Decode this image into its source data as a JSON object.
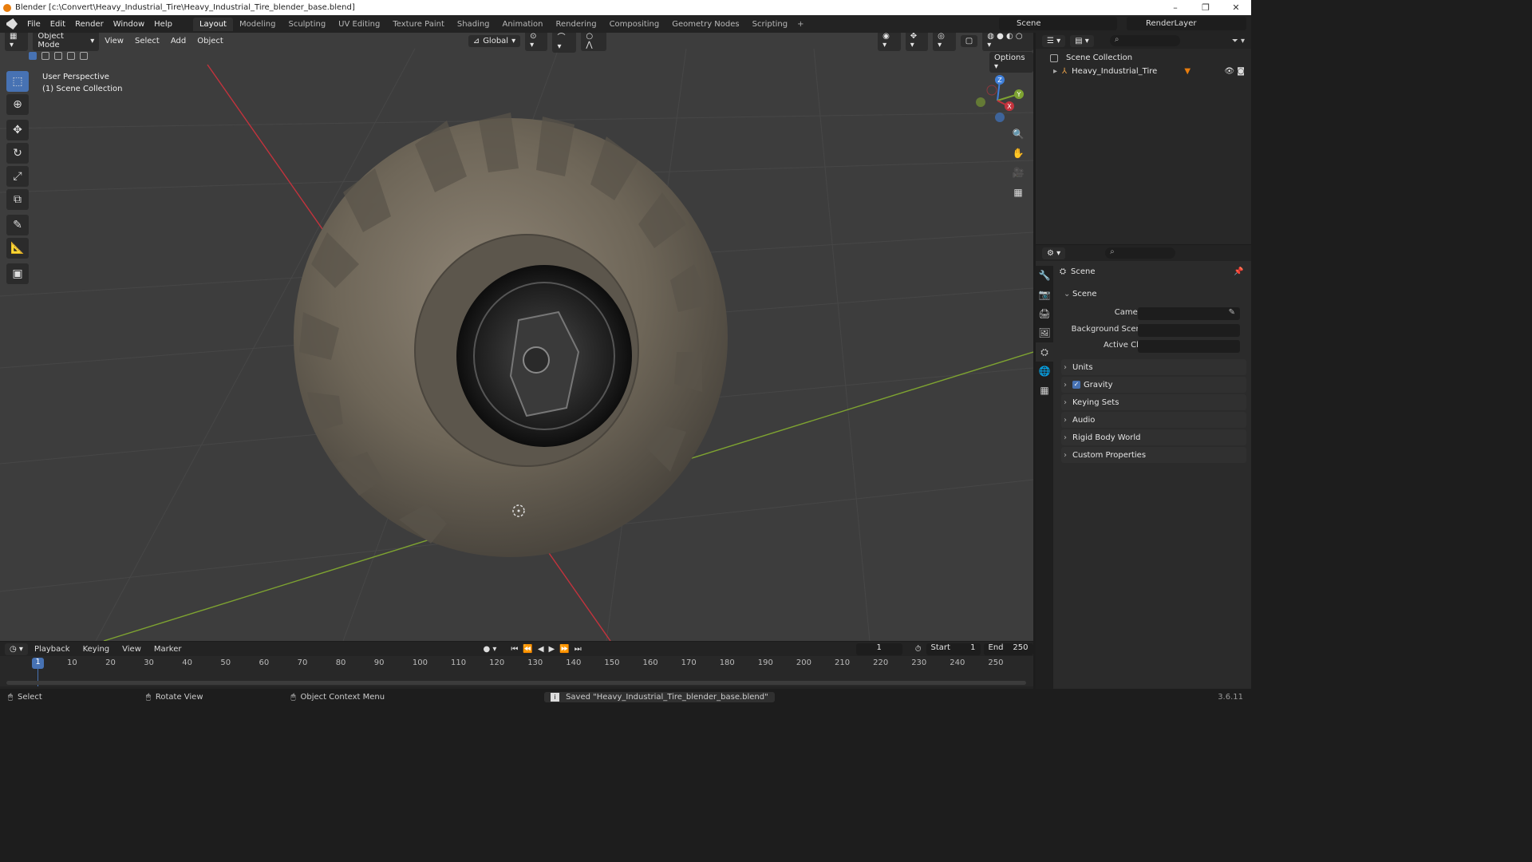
{
  "window": {
    "title": "Blender [c:\\Convert\\Heavy_Industrial_Tire\\Heavy_Industrial_Tire_blender_base.blend]",
    "min": "–",
    "max": "❐",
    "close": "✕"
  },
  "menu": [
    "File",
    "Edit",
    "Render",
    "Window",
    "Help"
  ],
  "workspaces": [
    "Layout",
    "Modeling",
    "Sculpting",
    "UV Editing",
    "Texture Paint",
    "Shading",
    "Animation",
    "Rendering",
    "Compositing",
    "Geometry Nodes",
    "Scripting"
  ],
  "add_workspace": "+",
  "scene_name": "Scene",
  "view_layer": "RenderLayer",
  "viewport": {
    "mode": "Object Mode",
    "menus": [
      "View",
      "Select",
      "Add",
      "Object"
    ],
    "orientation": "Global",
    "options": "Options",
    "perspective": "User Perspective",
    "collection": "(1) Scene Collection",
    "axes": {
      "x": "X",
      "y": "Y",
      "z": "Z"
    }
  },
  "outliner": {
    "root": "Scene Collection",
    "items": [
      "Heavy_Industrial_Tire"
    ]
  },
  "properties": {
    "title": "Scene",
    "section": "Scene",
    "fields": [
      {
        "label": "Camera"
      },
      {
        "label": "Background Scene"
      },
      {
        "label": "Active Clip"
      }
    ],
    "panels": [
      "Units",
      "Gravity",
      "Keying Sets",
      "Audio",
      "Rigid Body World",
      "Custom Properties"
    ]
  },
  "timeline": {
    "menus": [
      "Playback",
      "Keying",
      "View",
      "Marker"
    ],
    "current_frame": "1",
    "start_label": "Start",
    "start": "1",
    "end_label": "End",
    "end": "250",
    "ticks": [
      "10",
      "20",
      "30",
      "40",
      "50",
      "60",
      "70",
      "80",
      "90",
      "100",
      "110",
      "120",
      "130",
      "140",
      "150",
      "160",
      "170",
      "180",
      "190",
      "200",
      "210",
      "220",
      "230",
      "240",
      "250"
    ],
    "playhead": "1"
  },
  "status": {
    "select": "Select",
    "rotate": "Rotate View",
    "context": "Object Context Menu",
    "message": "Saved \"Heavy_Industrial_Tire_blender_base.blend\"",
    "version": "3.6.11"
  },
  "colors": {
    "accent": "#4772b3",
    "x_axis": "#c3333d",
    "y_axis": "#7ea331",
    "z_axis": "#3f7fd9"
  }
}
